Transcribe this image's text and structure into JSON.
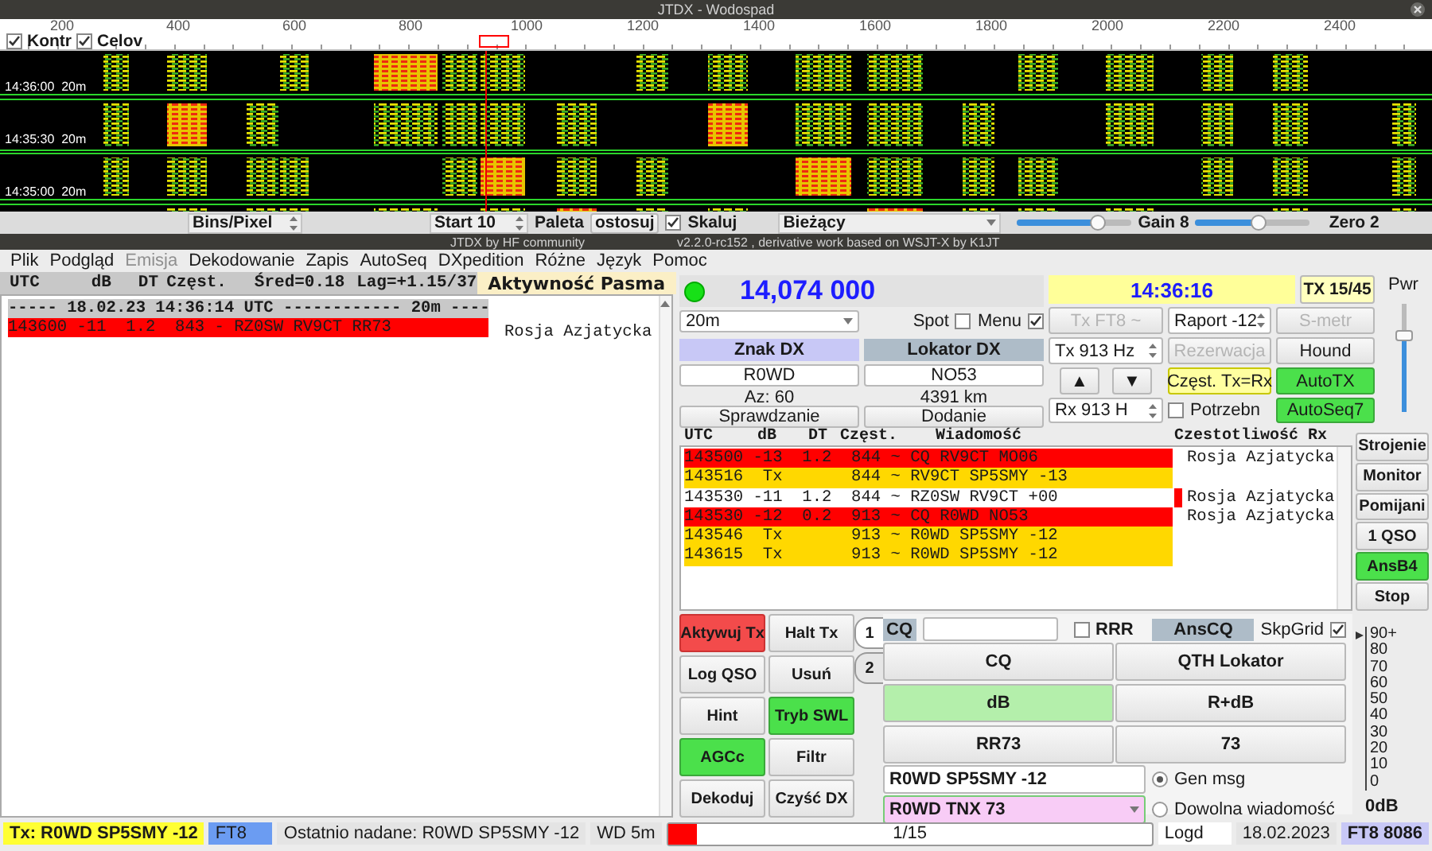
{
  "waterfall_window": {
    "title": "JTDX - Wodospad",
    "checkboxes": [
      {
        "label": "Kontr",
        "checked": true
      },
      {
        "label": "Celov",
        "checked": true
      }
    ],
    "scale_labels": [
      "200",
      "400",
      "600",
      "800",
      "1000",
      "1200",
      "1400",
      "1600",
      "1800",
      "2000",
      "2200",
      "2400"
    ],
    "time_labels": [
      "14:36:00  20m",
      "14:35:30  20m",
      "14:35:00  20m"
    ],
    "bins_per_pixel": "Bins/Pixel",
    "start": "Start 10",
    "palette_label": "Paleta",
    "adjust_button": "ostosuj",
    "scale_checkbox": {
      "label": "Skaluj",
      "checked": true
    },
    "spectrum_combo": "Bieżący",
    "slider": {
      "level": 0.7
    },
    "gain": {
      "label": "Gain 8",
      "level": 0.55
    },
    "zero": {
      "label": "Zero 2"
    }
  },
  "main_window": {
    "title": "JTDX by HF community",
    "subtitle": "v2.2.0-rc152 , derivative work based on WSJT-X by K1JT"
  },
  "menu": [
    {
      "label": "Plik",
      "disabled": false
    },
    {
      "label": "Podgląd",
      "disabled": false
    },
    {
      "label": "Emisja",
      "disabled": true
    },
    {
      "label": "Dekodowanie",
      "disabled": false
    },
    {
      "label": "Zapis",
      "disabled": false
    },
    {
      "label": "AutoSeq",
      "disabled": false
    },
    {
      "label": "DXpedition",
      "disabled": false
    },
    {
      "label": "Różne",
      "disabled": false
    },
    {
      "label": "Język",
      "disabled": false
    },
    {
      "label": "Pomoc",
      "disabled": false
    }
  ],
  "band_activity": {
    "columns": [
      "UTC",
      "dB",
      "DT",
      "Częst.",
      "Śred=0.18",
      "Lag=+1.15/37"
    ],
    "label": "Aktywność Pasma",
    "rows": [
      {
        "kind": "separator",
        "text": "----- 18.02.23 14:36:14 UTC ------------ 20m ----"
      },
      {
        "kind": "decode",
        "color": "#ff0000",
        "text": "143600 -11  1.2  843 - RZ0SW RV9CT RR73",
        "country": "Rosja Azjatycka"
      }
    ]
  },
  "control": {
    "frequency": "14,074 000",
    "time": "14:36:16",
    "tx_period": "TX 15/45",
    "band": "20m",
    "spot": {
      "label": "Spot",
      "checked": false
    },
    "menu_toggle": {
      "label": "Menu",
      "checked": true
    },
    "dx_call_header": "Znak DX",
    "dx_grid_header": "Lokator DX",
    "dx_call": "R0WD",
    "dx_grid": "NO53",
    "azimuth": "Az: 60",
    "distance": "4391 km",
    "lookup_button": "Sprawdzanie",
    "add_button": "Dodanie",
    "mode_button": {
      "label": "Tx FT8 ~",
      "disabled": true
    },
    "report": "Raport -12",
    "smeter_button": {
      "label": "S-metr",
      "disabled": true
    },
    "tx_freq": "Tx  913  Hz",
    "reservation_button": {
      "label": "Rezerwacja",
      "disabled": true
    },
    "hound_button": {
      "label": "Hound",
      "on": false
    },
    "up": "▲",
    "down": "▼",
    "tx_eq_rx_button": {
      "label": "Częst. Tx=Rx",
      "on": true
    },
    "autotx_button": {
      "label": "AutoTX",
      "on": true
    },
    "rx_freq": "Rx  913  H",
    "needed": {
      "label": "Potrzebn",
      "checked": false
    },
    "autoseq_button": {
      "label": "AutoSeq7",
      "on": true
    },
    "power": {
      "label": "Pwr",
      "level": 0.7
    }
  },
  "messages": {
    "columns": [
      "UTC",
      "dB",
      "DT",
      "Częst.",
      "Wiadomość"
    ],
    "rx_label": "Czestotliwość Rx",
    "rows": [
      {
        "color": "#ff0000",
        "text": "143500 -13  1.2  844 ~ CQ RV9CT MO06",
        "country": "Rosja Azjatycka",
        "marked": false
      },
      {
        "color": "#ffd800",
        "text": "143516  Tx       844 ~ RV9CT SP5SMY -13",
        "marked": false
      },
      {
        "color": "#ffffff",
        "text": "143530 -11  1.2  844 ~ RZ0SW RV9CT +00",
        "country": "Rosja Azjatycka",
        "marked": true
      },
      {
        "color": "#ff0000",
        "text": "143530 -12  0.2  913 ~ CQ R0WD NO53",
        "country": "Rosja Azjatycka",
        "marked": false
      },
      {
        "color": "#ffd800",
        "text": "143546  Tx       913 ~ R0WD SP5SMY -12",
        "marked": false
      },
      {
        "color": "#ffd800",
        "text": "143615  Tx       913 ~ R0WD SP5SMY -12",
        "marked": false
      }
    ],
    "side_buttons": [
      {
        "label": "Strojenie",
        "on": false
      },
      {
        "label": "Monitor",
        "on": false
      },
      {
        "label": "Pomijani",
        "on": false
      },
      {
        "label": "1 QSO",
        "on": false
      },
      {
        "label": "AnsB4",
        "on": true
      },
      {
        "label": "Stop",
        "on": false
      }
    ]
  },
  "tx_panel": {
    "buttons": [
      {
        "label": "Aktywuj Tx",
        "kind": "tx",
        "on": true
      },
      {
        "label": "Halt Tx",
        "kind": "normal",
        "on": false
      },
      {
        "label": "Log QSO",
        "kind": "normal",
        "on": false
      },
      {
        "label": "Usuń",
        "kind": "normal",
        "on": false
      },
      {
        "label": "Hint",
        "kind": "normal",
        "on": false
      },
      {
        "label": "Tryb SWL",
        "kind": "normal",
        "on": true
      },
      {
        "label": "AGCc",
        "kind": "normal",
        "on": true
      },
      {
        "label": "Filtr",
        "kind": "normal",
        "on": false
      },
      {
        "label": "Dekoduj",
        "kind": "normal",
        "on": false
      },
      {
        "label": "Czyść DX",
        "kind": "normal",
        "on": false
      }
    ],
    "tabs": [
      {
        "label": "1",
        "selected": true
      },
      {
        "label": "2",
        "selected": false
      }
    ],
    "cq_label": "CQ",
    "rrr": {
      "label": "RRR",
      "checked": false
    },
    "anscq": "AnsCQ",
    "skpgrid": {
      "label": "SkpGrid",
      "checked": true
    },
    "message_buttons": [
      {
        "label": "CQ",
        "selected": false
      },
      {
        "label": "QTH Lokator",
        "selected": false
      },
      {
        "label": "dB",
        "selected": true
      },
      {
        "label": "R+dB",
        "selected": false
      },
      {
        "label": "RR73",
        "selected": false
      },
      {
        "label": "73",
        "selected": false
      }
    ],
    "gen_message": "R0WD SP5SMY -12",
    "free_message": "R0WD TNX 73",
    "radios": [
      {
        "label": "Gen msg",
        "selected": true
      },
      {
        "label": "Dowolna wiadomość",
        "selected": false
      }
    ],
    "meter_scale": [
      "90+",
      "80",
      "70",
      "60",
      "50",
      "40",
      "30",
      "20",
      "10",
      "0"
    ],
    "meter_unit": "0dB"
  },
  "status_bar": {
    "tx": "Tx: R0WD SP5SMY -12",
    "mode": "FT8",
    "last_sent": "Ostatnio nadane: R0WD SP5SMY -12",
    "watchdog": "WD 5m",
    "progress": {
      "level": 0.06,
      "label": "1/15"
    },
    "log": "Logd",
    "date": "18.02.2023",
    "mode_id": "FT8  8086"
  }
}
